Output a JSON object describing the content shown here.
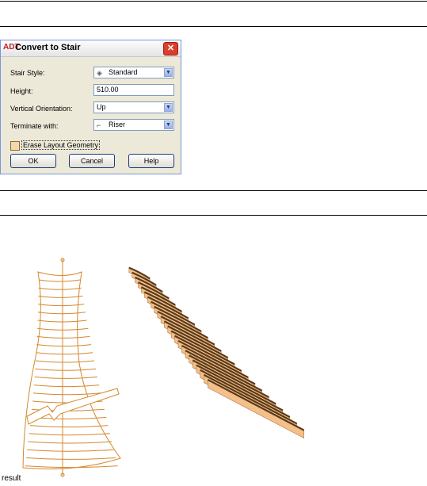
{
  "dialog": {
    "title": "Convert to Stair",
    "logo": "ADT",
    "close_icon": "close-icon",
    "fields": {
      "stair_style_label": "Stair Style:",
      "stair_style_value": "Standard",
      "height_label": "Height:",
      "height_value": "510.00",
      "vertical_orientation_label": "Vertical Orientation:",
      "vertical_orientation_value": "Up",
      "terminate_label": "Terminate with:",
      "terminate_value": "Riser"
    },
    "checkbox_label": "Erase Layout Geometry",
    "buttons": {
      "ok": "OK",
      "cancel": "Cancel",
      "help": "Help"
    }
  },
  "caption": "result",
  "colors": {
    "stair_line": "#d4882e",
    "tread_fill": "#f3c08a",
    "tread_edge": "#5a3a1a",
    "dialog_bg": "#ece9d8"
  }
}
